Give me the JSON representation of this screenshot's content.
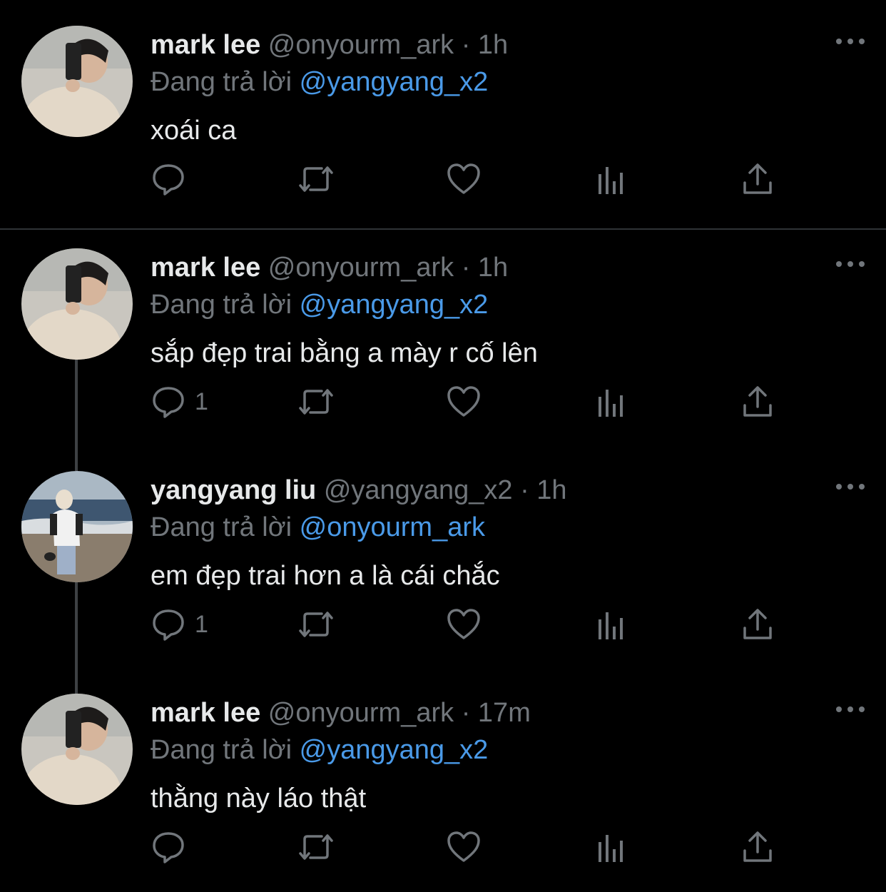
{
  "reply_prefix": "Đang trả lời",
  "tweets": [
    {
      "name": "mark lee",
      "handle": "@onyourm_ark",
      "separator": "·",
      "time": "1h",
      "reply_to": "@yangyang_x2",
      "text": "xoái ca",
      "reply_count": ""
    },
    {
      "name": "mark lee",
      "handle": "@onyourm_ark",
      "separator": "·",
      "time": "1h",
      "reply_to": "@yangyang_x2",
      "text": "sắp đẹp trai bằng a mày r cố lên",
      "reply_count": "1"
    },
    {
      "name": "yangyang liu",
      "handle": "@yangyang_x2",
      "separator": "·",
      "time": "1h",
      "reply_to": "@onyourm_ark",
      "text": "em đẹp trai hơn a là cái chắc",
      "reply_count": "1"
    },
    {
      "name": "mark lee",
      "handle": "@onyourm_ark",
      "separator": "·",
      "time": "17m",
      "reply_to": "@yangyang_x2",
      "text": "thằng này láo thật",
      "reply_count": ""
    }
  ],
  "icons": {
    "reply": "reply-icon",
    "retweet": "retweet-icon",
    "like": "heart-icon",
    "analytics": "analytics-icon",
    "share": "share-icon",
    "more": "more-icon"
  },
  "colors": {
    "background": "#000000",
    "text": "#e7e9ea",
    "secondary": "#71767b",
    "mention": "#4a9ae8",
    "thread_line": "#3e4144"
  }
}
